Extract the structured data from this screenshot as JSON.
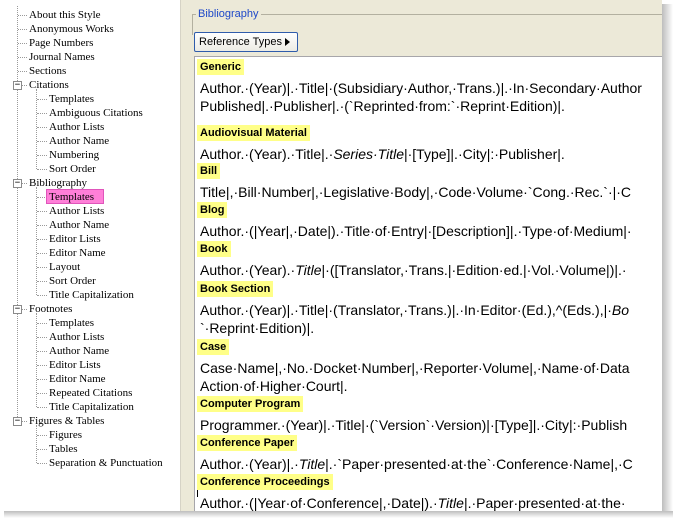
{
  "tree": {
    "items": [
      {
        "label": "About this Style",
        "level": 0,
        "expander": ""
      },
      {
        "label": "Anonymous Works",
        "level": 0,
        "expander": ""
      },
      {
        "label": "Page Numbers",
        "level": 0,
        "expander": ""
      },
      {
        "label": "Journal Names",
        "level": 0,
        "expander": ""
      },
      {
        "label": "Sections",
        "level": 0,
        "expander": ""
      },
      {
        "label": "Citations",
        "level": 0,
        "expander": "−"
      },
      {
        "label": "Templates",
        "level": 1,
        "expander": ""
      },
      {
        "label": "Ambiguous Citations",
        "level": 1,
        "expander": ""
      },
      {
        "label": "Author Lists",
        "level": 1,
        "expander": ""
      },
      {
        "label": "Author Name",
        "level": 1,
        "expander": ""
      },
      {
        "label": "Numbering",
        "level": 1,
        "expander": ""
      },
      {
        "label": "Sort Order",
        "level": 1,
        "expander": ""
      },
      {
        "label": "Bibliography",
        "level": 0,
        "expander": "−"
      },
      {
        "label": "Templates",
        "level": 1,
        "expander": "",
        "selected": true
      },
      {
        "label": "Author Lists",
        "level": 1,
        "expander": ""
      },
      {
        "label": "Author Name",
        "level": 1,
        "expander": ""
      },
      {
        "label": "Editor Lists",
        "level": 1,
        "expander": ""
      },
      {
        "label": "Editor Name",
        "level": 1,
        "expander": ""
      },
      {
        "label": "Layout",
        "level": 1,
        "expander": ""
      },
      {
        "label": "Sort Order",
        "level": 1,
        "expander": ""
      },
      {
        "label": "Title Capitalization",
        "level": 1,
        "expander": ""
      },
      {
        "label": "Footnotes",
        "level": 0,
        "expander": "−"
      },
      {
        "label": "Templates",
        "level": 1,
        "expander": ""
      },
      {
        "label": "Author Lists",
        "level": 1,
        "expander": ""
      },
      {
        "label": "Author Name",
        "level": 1,
        "expander": ""
      },
      {
        "label": "Editor Lists",
        "level": 1,
        "expander": ""
      },
      {
        "label": "Editor Name",
        "level": 1,
        "expander": ""
      },
      {
        "label": "Repeated Citations",
        "level": 1,
        "expander": ""
      },
      {
        "label": "Title Capitalization",
        "level": 1,
        "expander": ""
      },
      {
        "label": "Figures & Tables",
        "level": 0,
        "expander": "−"
      },
      {
        "label": "Figures",
        "level": 1,
        "expander": ""
      },
      {
        "label": "Tables",
        "level": 1,
        "expander": ""
      },
      {
        "label": "Separation & Punctuation",
        "level": 1,
        "expander": ""
      }
    ]
  },
  "panel": {
    "group_label": "Bibliography",
    "ref_types_button": "Reference Types"
  },
  "templates": [
    {
      "name": "Generic",
      "lines": [
        [
          {
            "t": "Author.·(Year)|.·Title|·(Subsidiary·Author,·Trans.)|.·In·Secondary·Author"
          }
        ],
        [
          {
            "t": "Published|.·Publisher|.·(`Reprinted·from:`·Reprint·Edition)|."
          }
        ]
      ]
    },
    {
      "name": "Audiovisual Material",
      "lines": [
        [
          {
            "t": "Author.·(Year).·Title|.·"
          },
          {
            "t": "Series·Title",
            "i": true
          },
          {
            "t": "|·[Type]|.·City|:·Publisher|."
          }
        ]
      ]
    },
    {
      "name": "Bill",
      "lines": [
        [
          {
            "t": "Title|,·Bill·Number|,·Legislative·Body|,·Code·Volume·`Cong.·Rec.`·|·C"
          }
        ]
      ]
    },
    {
      "name": "Blog",
      "lines": [
        [
          {
            "t": "Author.·(|Year|,·Date|).·Title·of·Entry|·[Description]|.·Type·of·Medium|·"
          }
        ]
      ]
    },
    {
      "name": "Book",
      "lines": [
        [
          {
            "t": "Author.·(Year).·"
          },
          {
            "t": "Title",
            "i": true
          },
          {
            "t": "|·([Translator,·Trans.|·Edition·ed.|·Vol.·Volume|)|.·"
          }
        ]
      ]
    },
    {
      "name": "Book Section",
      "lines": [
        [
          {
            "t": "Author.·(Year)|.·Title|·(Translator,·Trans.)|.·In·Editor·(Ed.),^(Eds.),|·"
          },
          {
            "t": "Bo",
            "i": true
          }
        ],
        [
          {
            "t": "`·Reprint·Edition)|."
          }
        ]
      ]
    },
    {
      "name": "Case",
      "lines": [
        [
          {
            "t": "Case·Name|,·No.·Docket·Number|,·Reporter·Volume|,·Name·of·Data"
          }
        ],
        [
          {
            "t": "Action·of·Higher·Court|."
          }
        ]
      ]
    },
    {
      "name": "Computer Program",
      "lines": [
        [
          {
            "t": "Programmer.·(Year)|.·Title|·(`Version`·Version)|·[Type]|.·City|:·Publish"
          }
        ]
      ]
    },
    {
      "name": "Conference Paper",
      "lines": [
        [
          {
            "t": "Author.·(Year)|.·"
          },
          {
            "t": "Title",
            "i": true
          },
          {
            "t": "|.·`Paper·presented·at·the`·Conference·Name|,·C"
          }
        ]
      ]
    },
    {
      "name": "Conference Proceedings",
      "lines": [
        [
          {
            "t": "Author.·(|Year·of·Conference|,·Date|).·"
          },
          {
            "t": "Title",
            "i": true
          },
          {
            "t": "|.·Paper·presented·at·the·"
          }
        ]
      ]
    }
  ],
  "colors": {
    "header_highlight": "#ffff88",
    "selected_item": "#ff7fd8",
    "panel_bg": "#ece9d8",
    "group_label": "#1e48c8"
  },
  "icons": {
    "expander_collapse": "minus-box-icon",
    "button_arrow": "triangle-right-icon"
  }
}
